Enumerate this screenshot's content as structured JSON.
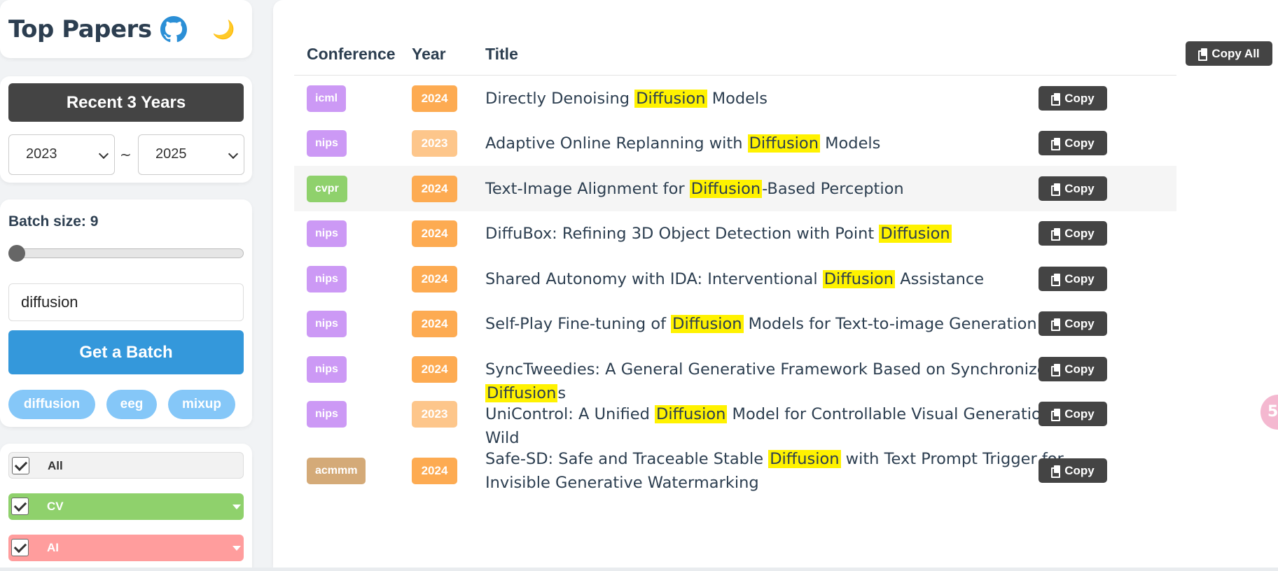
{
  "sidebar": {
    "brand": "Top Papers",
    "github_icon": "github-icon",
    "theme_icon": "moon-icon",
    "theme_glyph": "🌙",
    "recent_label": "Recent 3 Years",
    "year_from": "2023",
    "year_to": "2025",
    "year_separator": "~",
    "batch_label": "Batch size: 9",
    "batch_value": 9,
    "search_value": "diffusion",
    "get_batch_label": "Get a Batch",
    "chips": [
      "diffusion",
      "eeg",
      "mixup"
    ],
    "categories": [
      {
        "label": "All",
        "checked": true,
        "color": "#f2f2f2"
      },
      {
        "label": "CV",
        "checked": true,
        "color": "#8fd16c"
      },
      {
        "label": "AI",
        "checked": true,
        "color": "#ff9d9d"
      }
    ]
  },
  "table": {
    "headers": {
      "conference": "Conference",
      "year": "Year",
      "title": "Title"
    },
    "copy_all_label": "Copy All",
    "copy_label": "Copy",
    "rows": [
      {
        "conference": "icml",
        "conf_color": "#cc99f5",
        "year": "2024",
        "year_color": "#fdab52",
        "title_pre": "Directly Denoising ",
        "highlight": "Diffusion",
        "title_post": " Models"
      },
      {
        "conference": "nips",
        "conf_color": "#cc99f5",
        "year": "2023",
        "year_color": "#fdc68b",
        "title_pre": "Adaptive Online Replanning with ",
        "highlight": "Diffusion",
        "title_post": " Models"
      },
      {
        "conference": "cvpr",
        "conf_color": "#8fd16c",
        "year": "2024",
        "year_color": "#fdab52",
        "title_pre": "Text-Image Alignment for ",
        "highlight": "Diffusion",
        "title_post": "-Based Perception"
      },
      {
        "conference": "nips",
        "conf_color": "#cc99f5",
        "year": "2024",
        "year_color": "#fdab52",
        "title_pre": "DiffuBox: Refining 3D Object Detection with Point ",
        "highlight": "Diffusion",
        "title_post": ""
      },
      {
        "conference": "nips",
        "conf_color": "#cc99f5",
        "year": "2024",
        "year_color": "#fdab52",
        "title_pre": "Shared Autonomy with IDA: Interventional ",
        "highlight": "Diffusion",
        "title_post": " Assistance"
      },
      {
        "conference": "nips",
        "conf_color": "#cc99f5",
        "year": "2024",
        "year_color": "#fdab52",
        "title_pre": "Self-Play Fine-tuning of ",
        "highlight": "Diffusion",
        "title_post": " Models for Text-to-image Generation"
      },
      {
        "conference": "nips",
        "conf_color": "#cc99f5",
        "year": "2024",
        "year_color": "#fdab52",
        "title_pre": "SyncTweedies: A General Generative Framework Based on Synchronized ",
        "highlight": "Diffusion",
        "title_post": "s"
      },
      {
        "conference": "nips",
        "conf_color": "#cc99f5",
        "year": "2023",
        "year_color": "#fdc68b",
        "title_pre": "UniControl: A Unified ",
        "highlight": "Diffusion",
        "title_post": " Model for Controllable Visual Generation In the Wild"
      },
      {
        "conference": "acmmm",
        "conf_color": "#d4aa78",
        "year": "2024",
        "year_color": "#fdab52",
        "title_pre": "Safe-SD: Safe and Traceable Stable ",
        "highlight": "Diffusion",
        "title_post": " with Text Prompt Trigger for Invisible Generative Watermarking"
      }
    ]
  },
  "floating_button": {
    "glyph": "5"
  }
}
